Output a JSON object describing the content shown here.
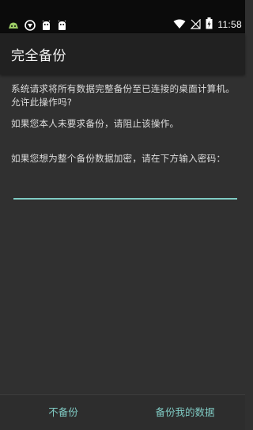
{
  "status_bar": {
    "time": "11:58",
    "icons": [
      "android-debug-icon",
      "app-notification-icon",
      "android-icon",
      "android-icon",
      "wifi-icon",
      "no-signal-icon",
      "battery-charging-icon"
    ]
  },
  "app_bar": {
    "title": "完全备份"
  },
  "dialog": {
    "message": "系统请求将所有数据完整备份至已连接的桌面计算机。允许此操作吗?",
    "warning": "如果您本人未要求备份，请阻止该操作。",
    "password_prompt": "如果您想为整个备份数据加密，请在下方输入密码：",
    "password_value": ""
  },
  "buttons": {
    "deny": "不备份",
    "allow": "备份我的数据"
  },
  "colors": {
    "accent": "#80cbc4",
    "background": "#303030",
    "app_bar": "#212121",
    "status_bar": "#0b0b0b"
  }
}
